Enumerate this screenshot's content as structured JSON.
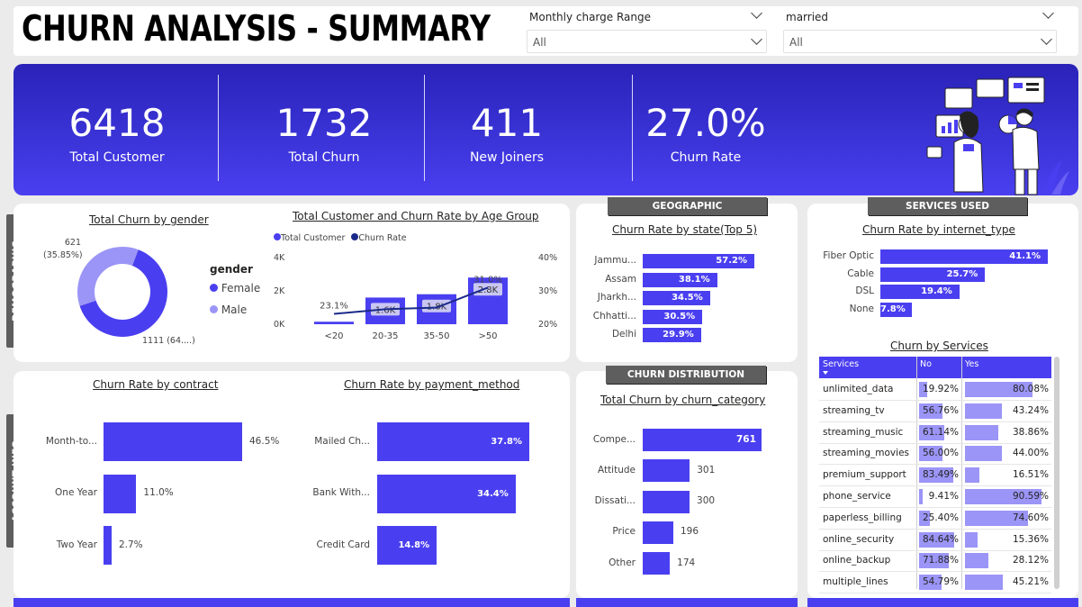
{
  "header": {
    "title": "CHURN ANALYSIS - SUMMARY",
    "filters": [
      {
        "label": "Monthly charge Range",
        "value": "All"
      },
      {
        "label": "married",
        "value": "All"
      }
    ]
  },
  "kpis": [
    {
      "value": "6418",
      "label": "Total Customer"
    },
    {
      "value": "1732",
      "label": "Total Churn"
    },
    {
      "value": "411",
      "label": "New Joiners"
    },
    {
      "value": "27.0%",
      "label": "Churn Rate"
    }
  ],
  "sections": {
    "demographic": "DEMOGRAPHIC",
    "account_info": "ACCOUNT INFO",
    "geographic": "GEOGRAPHIC",
    "churn_distribution": "CHURN DISTRIBUTION",
    "services_used": "SERVICES USED"
  },
  "colors": {
    "accent": "#4a3ff0",
    "light": "#9b95f7",
    "line": "#1a2a8a"
  },
  "chart_data": [
    {
      "type": "pie",
      "title": "Total Churn by gender",
      "legend_title": "gender",
      "legend_position": "right",
      "slices": [
        {
          "name": "Female",
          "value": 1111,
          "label": "1111 (64....)"
        },
        {
          "name": "Male",
          "value": 621,
          "label": "621 (35.85%)"
        }
      ]
    },
    {
      "type": "bar",
      "title": "Total Customer and Churn Rate by Age Group",
      "legend": [
        "Total Customer",
        "Churn Rate"
      ],
      "categories": [
        "<20",
        "20-35",
        "35-50",
        ">50"
      ],
      "series": [
        {
          "name": "Total Customer",
          "values": [
            150,
            1600,
            1800,
            2800
          ],
          "labels": [
            "",
            "1.6K",
            "1.8K",
            "2.8K"
          ]
        },
        {
          "name": "Churn Rate",
          "values": [
            23.1,
            24.5,
            25.0,
            31.0
          ],
          "labels": [
            "23.1%",
            "",
            "",
            "31.0%"
          ]
        }
      ],
      "y_ticks": [
        "0K",
        "2K",
        "4K"
      ],
      "y2_ticks": [
        "20%",
        "30%",
        "40%"
      ],
      "ylim": [
        0,
        4000
      ],
      "y2lim": [
        20,
        40
      ]
    },
    {
      "type": "bar",
      "title": "Churn Rate by state(Top 5)",
      "categories": [
        "Jammu...",
        "Assam",
        "Jharkh...",
        "Chhatti...",
        "Delhi"
      ],
      "values": [
        57.2,
        38.1,
        34.5,
        30.5,
        29.9
      ],
      "labels": [
        "57.2%",
        "38.1%",
        "34.5%",
        "30.5%",
        "29.9%"
      ]
    },
    {
      "type": "bar",
      "title": "Churn Rate by internet_type",
      "categories": [
        "Fiber Optic",
        "Cable",
        "DSL",
        "None"
      ],
      "values": [
        41.1,
        25.7,
        19.4,
        7.8
      ],
      "labels": [
        "41.1%",
        "25.7%",
        "19.4%",
        "7.8%"
      ]
    },
    {
      "type": "bar",
      "title": "Churn Rate by contract",
      "categories": [
        "Month-to...",
        "One Year",
        "Two Year"
      ],
      "values": [
        46.5,
        11.0,
        2.7
      ],
      "labels": [
        "46.5%",
        "11.0%",
        "2.7%"
      ]
    },
    {
      "type": "bar",
      "title": "Churn Rate by payment_method",
      "categories": [
        "Mailed Ch...",
        "Bank With...",
        "Credit Card"
      ],
      "values": [
        37.8,
        34.4,
        14.8
      ],
      "labels": [
        "37.8%",
        "34.4%",
        "14.8%"
      ]
    },
    {
      "type": "bar",
      "title": "Total Churn by churn_category",
      "categories": [
        "Compe...",
        "Attitude",
        "Dissati...",
        "Price",
        "Other"
      ],
      "values": [
        761,
        301,
        300,
        196,
        174
      ],
      "labels": [
        "761",
        "301",
        "300",
        "196",
        "174"
      ]
    },
    {
      "type": "table",
      "title": "Churn by Services",
      "columns": [
        "Services",
        "No",
        "Yes"
      ],
      "rows": [
        {
          "name": "unlimited_data",
          "no": 19.92,
          "yes": 80.08,
          "no_label": "19.92%",
          "yes_label": "80.08%"
        },
        {
          "name": "streaming_tv",
          "no": 56.76,
          "yes": 43.24,
          "no_label": "56.76%",
          "yes_label": "43.24%"
        },
        {
          "name": "streaming_music",
          "no": 61.14,
          "yes": 38.86,
          "no_label": "61.14%",
          "yes_label": "38.86%"
        },
        {
          "name": "streaming_movies",
          "no": 56.0,
          "yes": 44.0,
          "no_label": "56.00%",
          "yes_label": "44.00%"
        },
        {
          "name": "premium_support",
          "no": 83.49,
          "yes": 16.51,
          "no_label": "83.49%",
          "yes_label": "16.51%"
        },
        {
          "name": "phone_service",
          "no": 9.41,
          "yes": 90.59,
          "no_label": "9.41%",
          "yes_label": "90.59%"
        },
        {
          "name": "paperless_billing",
          "no": 25.4,
          "yes": 74.6,
          "no_label": "25.40%",
          "yes_label": "74.60%"
        },
        {
          "name": "online_security",
          "no": 84.64,
          "yes": 15.36,
          "no_label": "84.64%",
          "yes_label": "15.36%"
        },
        {
          "name": "online_backup",
          "no": 71.88,
          "yes": 28.12,
          "no_label": "71.88%",
          "yes_label": "28.12%"
        },
        {
          "name": "multiple_lines",
          "no": 54.79,
          "yes": 45.21,
          "no_label": "54.79%",
          "yes_label": "45.21%"
        }
      ]
    }
  ]
}
